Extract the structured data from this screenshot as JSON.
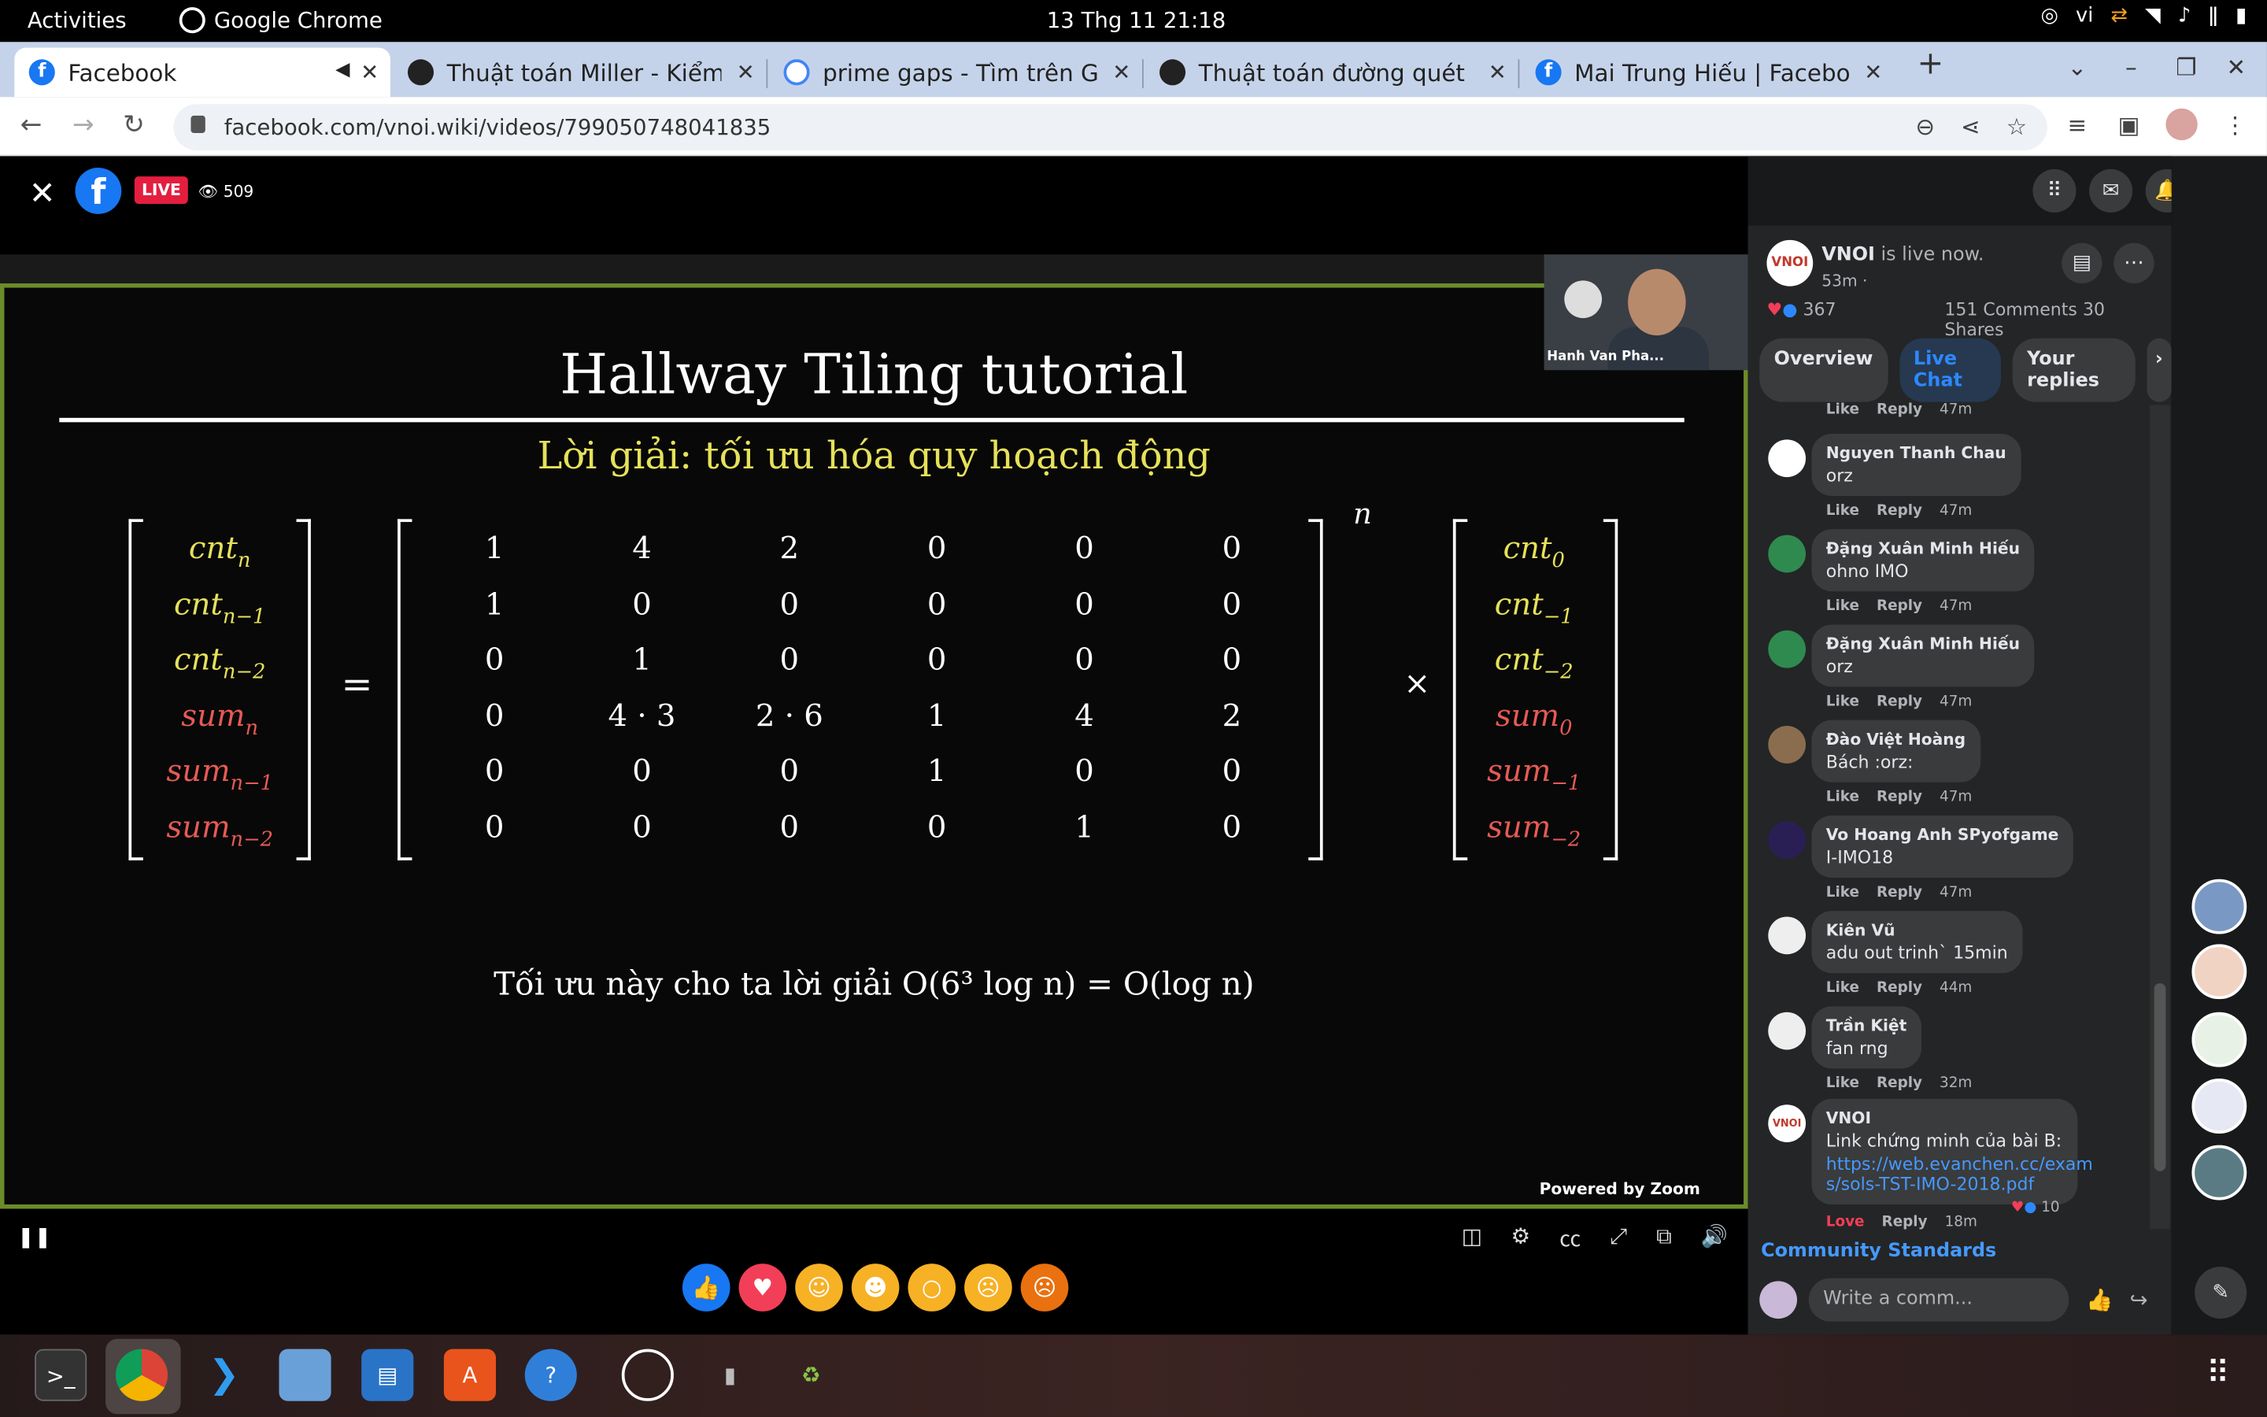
{
  "system": {
    "activities": "Activities",
    "app_name": "Google Chrome",
    "clock": "13 Thg 11  21:18",
    "lang": "vi"
  },
  "tabs": [
    {
      "title": "Facebook"
    },
    {
      "title": "Thuật toán Miller - Kiểm"
    },
    {
      "title": "prime gaps - Tìm trên Goo"
    },
    {
      "title": "Thuật toán đường quét"
    },
    {
      "title": "Mai Trung Hiếu | Faceboo"
    }
  ],
  "address": {
    "url": "facebook.com/vnoi.wiki/videos/799050748041835"
  },
  "video": {
    "live_label": "LIVE",
    "viewers": "509",
    "zoom_name": "Hanh Van Pha...",
    "powered_by": "Powered by Zoom"
  },
  "slide": {
    "title": "Hallway Tiling tutorial",
    "subtitle": "Lời giải: tối ưu hóa quy hoạch động",
    "lhs": [
      {
        "base": "cnt",
        "sub": "n"
      },
      {
        "base": "cnt",
        "sub": "n−1"
      },
      {
        "base": "cnt",
        "sub": "n−2"
      },
      {
        "base": "sum",
        "sub": "n"
      },
      {
        "base": "sum",
        "sub": "n−1"
      },
      {
        "base": "sum",
        "sub": "n−2"
      }
    ],
    "equals": "=",
    "matrix": [
      [
        "1",
        "4",
        "2",
        "0",
        "0",
        "0"
      ],
      [
        "1",
        "0",
        "0",
        "0",
        "0",
        "0"
      ],
      [
        "0",
        "1",
        "0",
        "0",
        "0",
        "0"
      ],
      [
        "0",
        "4 · 3",
        "2 · 6",
        "1",
        "4",
        "2"
      ],
      [
        "0",
        "0",
        "0",
        "1",
        "0",
        "0"
      ],
      [
        "0",
        "0",
        "0",
        "0",
        "1",
        "0"
      ]
    ],
    "power": "n",
    "times": "×",
    "rhs": [
      {
        "base": "cnt",
        "sub": "0"
      },
      {
        "base": "cnt",
        "sub": "−1"
      },
      {
        "base": "cnt",
        "sub": "−2"
      },
      {
        "base": "sum",
        "sub": "0"
      },
      {
        "base": "sum",
        "sub": "−1"
      },
      {
        "base": "sum",
        "sub": "−2"
      }
    ],
    "formula": "Tối ưu này cho ta lời giải O(6³ log n) = O(log n)"
  },
  "post": {
    "page": "VNOI",
    "status": "is live now.",
    "age": "53m ·",
    "reactions": "367",
    "comments": "151 Comments",
    "shares": "30 Shares",
    "tabs": [
      "Overview",
      "Live Chat",
      "Your replies"
    ]
  },
  "chat": {
    "like": "Like",
    "reply": "Reply",
    "top_time": "47m",
    "messages": [
      {
        "name": "Nguyen Thanh Chau",
        "text": "orz",
        "time": "47m"
      },
      {
        "name": "Đặng Xuân Minh Hiếu",
        "text": "ohno IMO",
        "time": "47m"
      },
      {
        "name": "Đặng Xuân Minh Hiếu",
        "text": "orz",
        "time": "47m"
      },
      {
        "name": "Đào Việt Hoàng",
        "text": "Bách :orz:",
        "time": "47m"
      },
      {
        "name": "Vo Hoang Anh SPyofgame",
        "text": "I-IMO18",
        "time": "47m"
      },
      {
        "name": "Kiên Vũ",
        "text": "adu out trinh` 15min",
        "time": "44m"
      },
      {
        "name": "Trần Kiệt",
        "text": "fan rng",
        "time": "32m"
      }
    ],
    "last": {
      "name": "VNOI",
      "text": "Link chứng minh của bài B:",
      "link1": "https://web.evanchen.cc/exam",
      "link2": "s/sols-TST-IMO-2018.pdf",
      "love": "Love",
      "reply": "Reply",
      "time": "18m",
      "count": "10"
    },
    "community": "Community Standards",
    "placeholder": "Write a comm..."
  },
  "colors": {
    "accent": "#2d88ff",
    "live": "#e41e3f",
    "slide_border": "#6b8c2a",
    "yellow": "#e6e15a",
    "red": "#e65a55"
  }
}
